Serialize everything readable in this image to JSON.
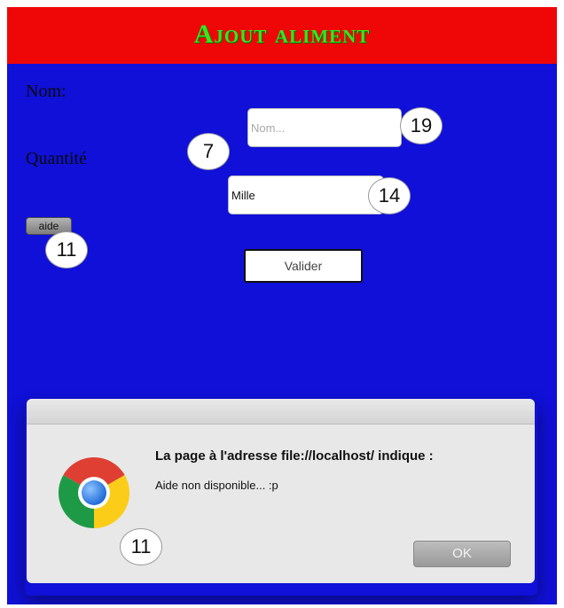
{
  "header": {
    "title": "Ajout aliment"
  },
  "form": {
    "nom_label": "Nom:",
    "nom_placeholder": "Nom...",
    "quantite_label": "Quantité",
    "quantite_value": "Mille",
    "aide_label": "aide",
    "valider_label": "Valider"
  },
  "annotations": {
    "nom_input_badge": "19",
    "quantite_label_badge": "7",
    "quantite_input_badge": "14",
    "aide_button_badge": "11",
    "dialog_badge": "11"
  },
  "dialog": {
    "title": "La page à l'adresse file://localhost/ indique :",
    "message": "Aide non disponible... :p",
    "ok_label": "OK",
    "icon": "chrome-logo"
  },
  "colors": {
    "page_background": "#1010d8",
    "header_background": "#ef0707",
    "title_color": "#33e81f"
  }
}
